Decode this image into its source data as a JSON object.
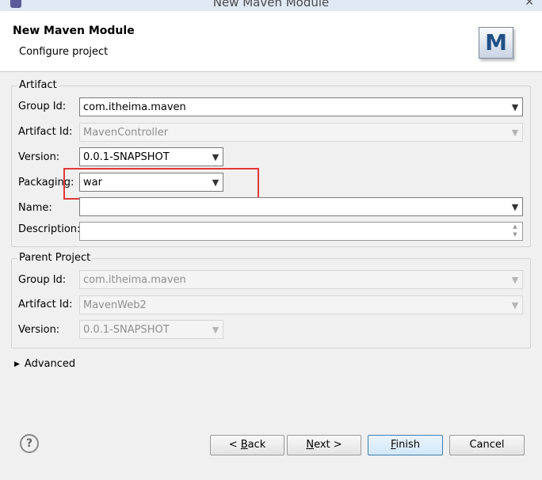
{
  "window": {
    "title": "New Maven Module"
  },
  "header": {
    "title": "New Maven Module",
    "subtitle": "Configure project",
    "logo_letter": "M"
  },
  "artifact": {
    "legend": "Artifact",
    "group_id": {
      "label": "Group Id:",
      "value": "com.itheima.maven"
    },
    "artifact_id": {
      "label": "Artifact Id:",
      "value": "MavenController"
    },
    "version": {
      "label": "Version:",
      "value": "0.0.1-SNAPSHOT"
    },
    "packaging": {
      "label": "Packaging:",
      "value": "war"
    },
    "name": {
      "label": "Name:",
      "value": ""
    },
    "description": {
      "label": "Description:",
      "value": ""
    }
  },
  "parent": {
    "legend": "Parent Project",
    "group_id": {
      "label": "Group Id:",
      "value": "com.itheima.maven"
    },
    "artifact_id": {
      "label": "Artifact Id:",
      "value": "MavenWeb2"
    },
    "version": {
      "label": "Version:",
      "value": "0.0.1-SNAPSHOT"
    }
  },
  "advanced": {
    "label": "Advanced"
  },
  "buttons": {
    "back_pre": "< ",
    "back_mn": "B",
    "back_post": "ack",
    "next_mn": "N",
    "next_post": "ext >",
    "finish_mn": "F",
    "finish_post": "inish",
    "cancel": "Cancel"
  },
  "colors": {
    "highlight": "#e23838",
    "accent": "#3c7fb1"
  }
}
